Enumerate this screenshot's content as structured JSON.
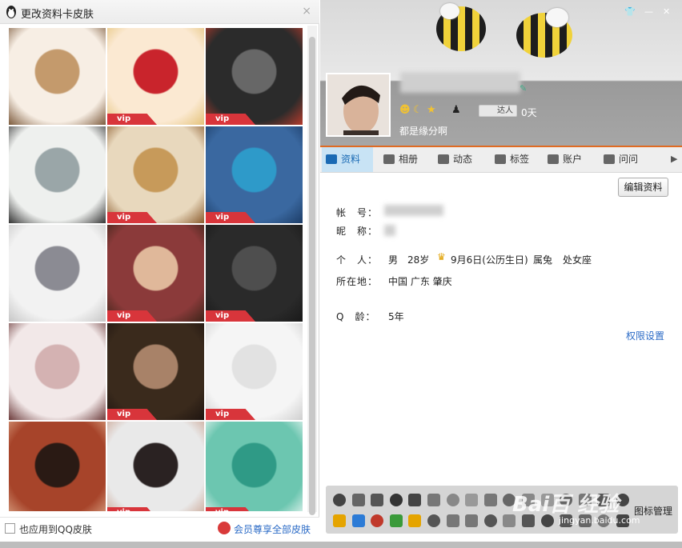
{
  "left_panel": {
    "title": "更改资料卡皮肤",
    "close_label": "×",
    "vip_label": "vip",
    "skins": [
      {
        "name": "kitten-bag",
        "vip": false,
        "colors": [
          "#f7eee4",
          "#c49a6c",
          "#7c5a3c"
        ]
      },
      {
        "name": "red-lantern",
        "vip": true,
        "colors": [
          "#fbe9d2",
          "#c9242c",
          "#e4c27a"
        ]
      },
      {
        "name": "scratched-metal",
        "vip": true,
        "colors": [
          "#2b2b2b",
          "#676767",
          "#b53b2c"
        ]
      },
      {
        "name": "kitten-glasses",
        "vip": false,
        "colors": [
          "#eef0ee",
          "#9aa6a8",
          "#333333"
        ]
      },
      {
        "name": "latte-snowflake",
        "vip": true,
        "colors": [
          "#e8d8bd",
          "#c79a5a",
          "#8a5a2c"
        ]
      },
      {
        "name": "denim-penguin",
        "vip": true,
        "colors": [
          "#3a68a0",
          "#2e9ac9",
          "#1c3c66"
        ]
      },
      {
        "name": "kitten-bowl",
        "vip": false,
        "colors": [
          "#f2f2f2",
          "#8b8b93",
          "#c6c6c6"
        ]
      },
      {
        "name": "girl-roses",
        "vip": true,
        "colors": [
          "#8b3a3a",
          "#e0b89a",
          "#3b2418"
        ]
      },
      {
        "name": "dark-wood",
        "vip": true,
        "colors": [
          "#2a2a2a",
          "#4e4e4e",
          "#191919"
        ]
      },
      {
        "name": "pink-kitten",
        "vip": false,
        "colors": [
          "#f2e8e8",
          "#d4b2b2",
          "#6b3a3a"
        ]
      },
      {
        "name": "girl-hat",
        "vip": true,
        "colors": [
          "#3a2a1c",
          "#a88268",
          "#1e1410"
        ]
      },
      {
        "name": "white-diamond",
        "vip": true,
        "colors": [
          "#f5f5f5",
          "#e2e2e2",
          "#cfcfcf"
        ]
      },
      {
        "name": "woman-room",
        "vip": false,
        "colors": [
          "#a7442a",
          "#2a1a14",
          "#d9a283"
        ]
      },
      {
        "name": "girl-hands",
        "vip": true,
        "colors": [
          "#e9e9e9",
          "#2a2222",
          "#c9a290"
        ]
      },
      {
        "name": "green-glass",
        "vip": true,
        "colors": [
          "#6cc6b0",
          "#2f9a86",
          "#e8f6f2"
        ]
      }
    ],
    "footer_checkbox_label": "也应用到QQ皮肤",
    "footer_link": "会员尊享全部皮肤"
  },
  "profile": {
    "signature": "都是缘分啊",
    "badge_label": "达人",
    "days": "0天",
    "tabs": [
      {
        "label": "资料",
        "active": true
      },
      {
        "label": "相册",
        "active": false
      },
      {
        "label": "动态",
        "active": false
      },
      {
        "label": "标签",
        "active": false
      },
      {
        "label": "账户",
        "active": false
      },
      {
        "label": "问问",
        "active": false
      }
    ],
    "edit_button": "编辑资料",
    "fields": {
      "account_label": "帐　号：",
      "nickname_label": "昵　称：",
      "personal_label": "个　人：",
      "gender": "男",
      "age": "28岁",
      "birthday": "9月6日(公历生日)",
      "zodiac_animal": "属兔",
      "zodiac_sign": "处女座",
      "location_label": "所在地：",
      "location": "中国 广东 肇庆",
      "qage_label": "Q　龄：",
      "qage": "5年"
    },
    "permission_link": "权限设置",
    "icon_manager": "图标管理",
    "watermark": "Bai百 经验",
    "watermark_url": "jingyan.baidu.com"
  }
}
